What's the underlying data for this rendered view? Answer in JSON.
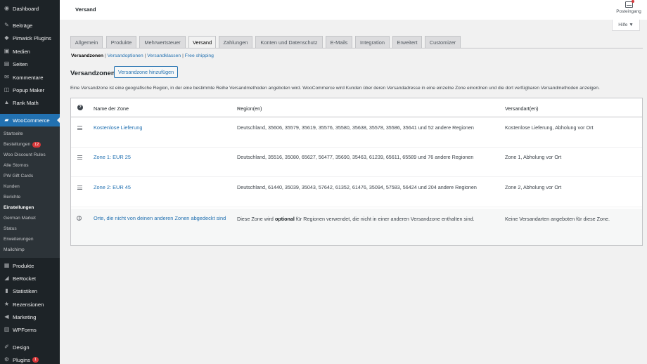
{
  "sidebar": {
    "items": [
      {
        "label": "Dashboard",
        "icon": "dashboard-icon",
        "glyph": "◉"
      },
      {
        "label": "Beiträge",
        "icon": "pin-icon",
        "glyph": "✎"
      },
      {
        "label": "Pimwick Plugins",
        "icon": "plugin-icon",
        "glyph": "◆"
      },
      {
        "label": "Medien",
        "icon": "media-icon",
        "glyph": "▣"
      },
      {
        "label": "Seiten",
        "icon": "page-icon",
        "glyph": "▤"
      },
      {
        "label": "Kommentare",
        "icon": "comment-icon",
        "glyph": "✉"
      },
      {
        "label": "Popup Maker",
        "icon": "popup-icon",
        "glyph": "◫"
      },
      {
        "label": "Rank Math",
        "icon": "chart-icon",
        "glyph": "▲"
      },
      {
        "label": "WooCommerce",
        "icon": "woo-icon",
        "glyph": "▰"
      },
      {
        "label": "Produkte",
        "icon": "box-icon",
        "glyph": "▦"
      },
      {
        "label": "BeRocket",
        "icon": "rocket-icon",
        "glyph": "◢"
      },
      {
        "label": "Statistiken",
        "icon": "stats-icon",
        "glyph": "▮"
      },
      {
        "label": "Rezensionen",
        "icon": "star-icon",
        "glyph": "★"
      },
      {
        "label": "Marketing",
        "icon": "megaphone-icon",
        "glyph": "◀"
      },
      {
        "label": "WPForms",
        "icon": "form-icon",
        "glyph": "▥"
      },
      {
        "label": "Design",
        "icon": "brush-icon",
        "glyph": "✐"
      },
      {
        "label": "Plugins",
        "icon": "plug-icon",
        "glyph": "⚙",
        "badge": "1"
      }
    ],
    "submenu": [
      {
        "label": "Startseite"
      },
      {
        "label": "Bestellungen",
        "badge": "12"
      },
      {
        "label": "Woo Discount Rules"
      },
      {
        "label": "Alle Stornos"
      },
      {
        "label": "PW Gift Cards"
      },
      {
        "label": "Kunden"
      },
      {
        "label": "Berichte"
      },
      {
        "label": "Einstellungen"
      },
      {
        "label": "German Market"
      },
      {
        "label": "Status"
      },
      {
        "label": "Erweiterungen"
      },
      {
        "label": "Mailchimp"
      }
    ]
  },
  "header": {
    "title": "Versand",
    "inbox_label": "Posteingang",
    "help_label": "Hilfe ▼"
  },
  "tabs": [
    {
      "label": "Allgemein"
    },
    {
      "label": "Produkte"
    },
    {
      "label": "Mehrwertsteuer"
    },
    {
      "label": "Versand"
    },
    {
      "label": "Zahlungen"
    },
    {
      "label": "Konten und Datenschutz"
    },
    {
      "label": "E-Mails"
    },
    {
      "label": "Integration"
    },
    {
      "label": "Erweitert"
    },
    {
      "label": "Customizer"
    }
  ],
  "subnav": {
    "current": "Versandzonen",
    "links": [
      "Versandoptionen",
      "Versandklassen",
      "Free shipping"
    ],
    "separator": " | "
  },
  "zones": {
    "title": "Versandzonen",
    "add_button": "Versandzone hinzufügen",
    "description": "Eine Versandzone ist eine geografische Region, in der eine bestimmte Reihe Versandmethoden angeboten wird. WooCommerce wird Kunden über deren Versandadresse in eine einzelne Zone einordnen und die dort verfügbaren Versandmethoden anzeigen.",
    "columns": {
      "name": "Name der Zone",
      "region": "Region(en)",
      "method": "Versandart(en)",
      "help": "?"
    },
    "rows": [
      {
        "name": "Kostenlose Lieferung",
        "region": "Deutschland, 35606, 35579, 35619, 35576, 35580, 35638, 35578, 35586, 35641 und 52 andere Regionen",
        "method": "Kostenlose Lieferung, Abholung vor Ort"
      },
      {
        "name": "Zone 1: EUR 25",
        "region": "Deutschland, 35516, 35080, 65627, 56477, 35690, 35463, 61239, 65611, 65589 und 76 andere Regionen",
        "method": "Zone 1, Abholung vor Ort"
      },
      {
        "name": "Zone 2: EUR 45",
        "region": "Deutschland, 61440, 35039, 35043, 57642, 61352, 61476, 35094, 57583, 56424 und 204 andere Regionen",
        "method": "Zone 2, Abholung vor Ort"
      }
    ],
    "other": {
      "name": "Orte, die nicht von deinen anderen Zonen abgedeckt sind",
      "region_before": "Diese Zone wird ",
      "region_bold": "optional",
      "region_after": " für Regionen verwendet, die nicht in einer anderen Versandzone enthalten sind.",
      "method": "Keine Versandarten angeboten für diese Zone."
    }
  },
  "colors": {
    "accent": "#2271b1",
    "sidebar": "#1d2327",
    "badge": "#d63638"
  }
}
